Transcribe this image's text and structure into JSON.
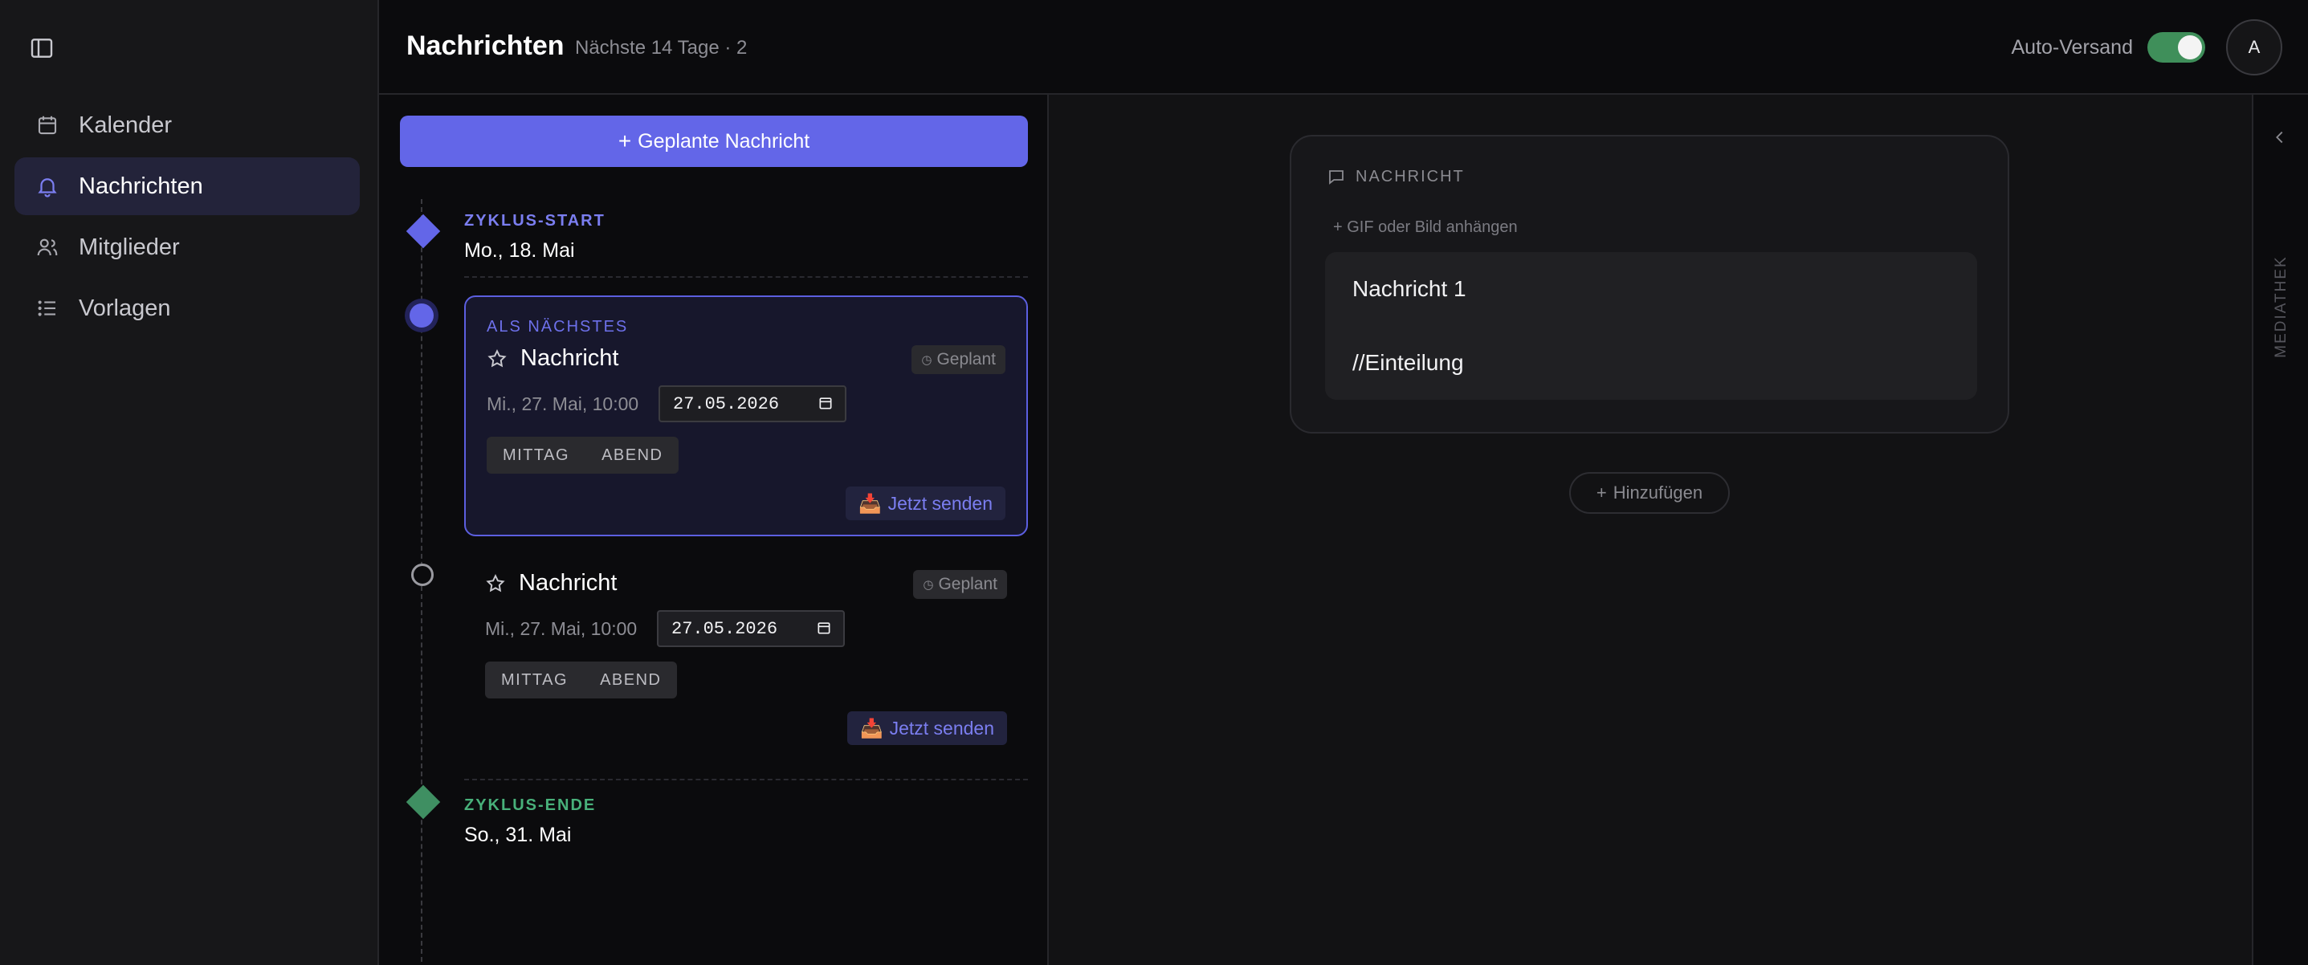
{
  "sidebar": {
    "items": [
      {
        "label": "Kalender",
        "icon": "calendar-icon"
      },
      {
        "label": "Nachrichten",
        "icon": "bell-icon",
        "active": true
      },
      {
        "label": "Mitglieder",
        "icon": "users-icon"
      },
      {
        "label": "Vorlagen",
        "icon": "list-icon"
      }
    ]
  },
  "header": {
    "title": "Nachrichten",
    "subtitle": "Nächste 14 Tage · 2",
    "auto_send_label": "Auto-Versand",
    "auto_send_on": true,
    "avatar_initial": "A"
  },
  "timeline": {
    "new_button_label": "Geplante Nachricht",
    "start": {
      "label": "ZYKLUS-START",
      "date": "Mo., 18. Mai"
    },
    "end": {
      "label": "ZYKLUS-ENDE",
      "date": "So., 31. Mai"
    },
    "cards": [
      {
        "tag": "ALS NÄCHSTES",
        "title": "Nachricht",
        "status": "Geplant",
        "datetime": "Mi., 27. Mai, 10:00",
        "date_value": "27.05.2026",
        "segments": [
          "MITTAG",
          "ABEND"
        ],
        "send_label": "Jetzt senden"
      },
      {
        "title": "Nachricht",
        "status": "Geplant",
        "datetime": "Mi., 27. Mai, 10:00",
        "date_value": "27.05.2026",
        "segments": [
          "MITTAG",
          "ABEND"
        ],
        "send_label": "Jetzt senden"
      }
    ]
  },
  "message": {
    "section_label": "NACHRICHT",
    "attach_label": "+ GIF oder Bild anhängen",
    "line1": "Nachricht 1",
    "line2": "//Einteilung",
    "add_label": "Hinzufügen"
  },
  "rail": {
    "label": "MEDIATHEK"
  },
  "colors": {
    "accent": "#6366e8",
    "success": "#3f8f5a",
    "background": "#0b0b0d",
    "sidebar": "#171719"
  }
}
